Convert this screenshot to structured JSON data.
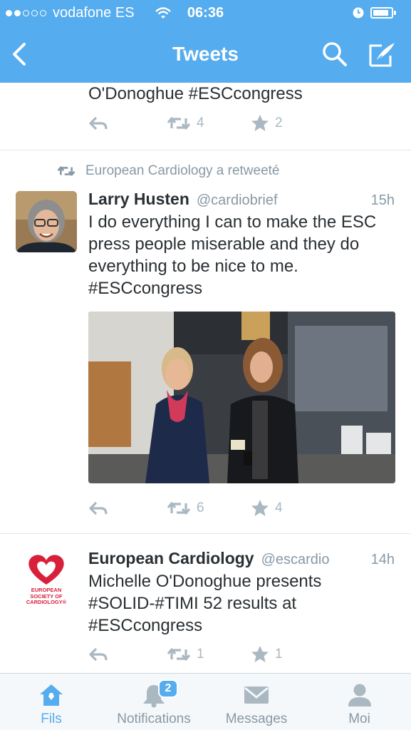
{
  "status_bar": {
    "carrier": "vodafone ES",
    "time": "06:36",
    "signal_bars_filled": 2,
    "signal_bars_total": 5,
    "battery_level": 0.75
  },
  "nav": {
    "title": "Tweets",
    "back_icon": "chevron-left-icon",
    "search_icon": "search-icon",
    "compose_icon": "compose-icon"
  },
  "tweets": [
    {
      "text": "O'Donoghue #ESCcongress",
      "retweets": "4",
      "favorites": "2"
    },
    {
      "retweeted_by": "European Cardiology a retweeté",
      "name": "Larry Husten",
      "handle": "@cardiobrief",
      "time": "15h",
      "text": "I do everything I can to make the ESC press people miserable and they do everything to be nice to me. #ESCcongress",
      "retweets": "6",
      "favorites": "4"
    },
    {
      "name": "European Cardiology",
      "handle": "@escardio",
      "time": "14h",
      "text": "Michelle O'Donoghue presents #SOLID-#TIMI 52 results at #ESCcongress",
      "retweets": "1",
      "favorites": "1",
      "logo_text": "EUROPEAN SOCIETY OF CARDIOLOGY®"
    }
  ],
  "tabbar": {
    "items": [
      {
        "label": "Fils",
        "icon": "home-icon",
        "active": true
      },
      {
        "label": "Notifications",
        "icon": "bell-icon",
        "badge": "2"
      },
      {
        "label": "Messages",
        "icon": "envelope-icon"
      },
      {
        "label": "Moi",
        "icon": "person-icon"
      }
    ]
  },
  "colors": {
    "brand_blue": "#55acee",
    "muted": "#aab8c2",
    "text": "#292f33",
    "esc_red": "#d9203a"
  }
}
